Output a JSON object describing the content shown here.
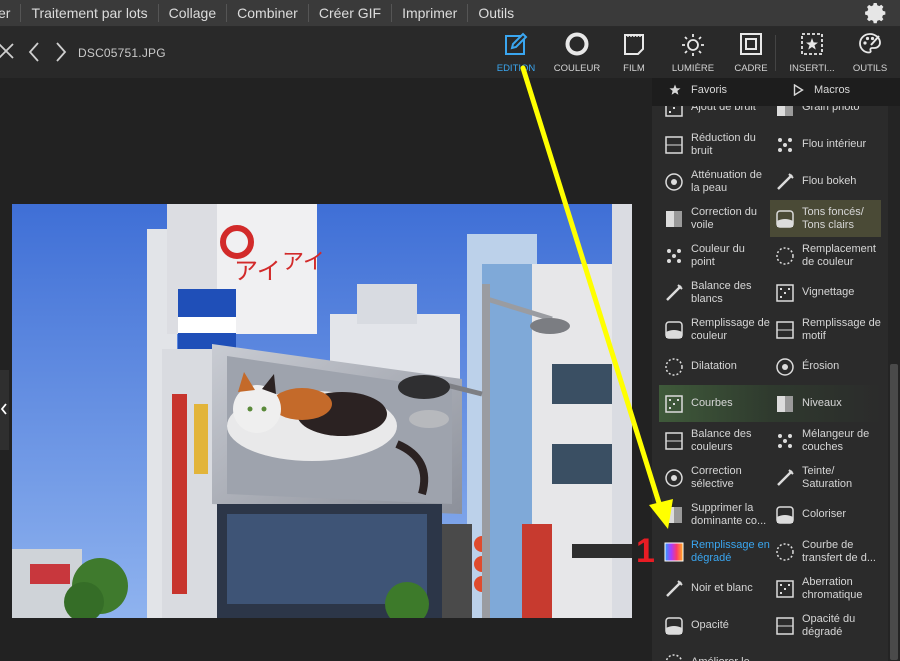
{
  "menu": {
    "items": [
      "er",
      "Traitement par lots",
      "Collage",
      "Combiner",
      "Créer GIF",
      "Imprimer",
      "Outils"
    ],
    "settings_icon": "gear-icon"
  },
  "toolbar": {
    "filename": "DSC05751.JPG",
    "tools": [
      {
        "label": "EDITION",
        "icon": "pencil-box-icon",
        "active": true
      },
      {
        "label": "COULEUR",
        "icon": "circle-icon"
      },
      {
        "label": "FILM",
        "icon": "film-frame-icon"
      },
      {
        "label": "LUMIÈRE",
        "icon": "sun-icon"
      },
      {
        "label": "CADRE",
        "icon": "frame-icon"
      },
      {
        "label": "INSERTI...",
        "icon": "insert-star-icon"
      },
      {
        "label": "OUTILS",
        "icon": "palette-icon"
      }
    ],
    "accent_color": "#3aa6f0"
  },
  "panel": {
    "tabs": [
      {
        "label": "Favoris",
        "icon": "star-icon"
      },
      {
        "label": "Macros",
        "icon": "play-icon"
      }
    ],
    "tools_left": [
      [
        "Ajout de bruit"
      ],
      [
        "Réduction du",
        "bruit"
      ],
      [
        "Atténuation de",
        "la peau"
      ],
      [
        "Correction du",
        "voile"
      ],
      [
        "Couleur du",
        "point"
      ],
      [
        "Balance des",
        "blancs"
      ],
      [
        "Remplissage de",
        "couleur"
      ],
      [
        "Dilatation"
      ],
      [
        "Courbes"
      ],
      [
        "Balance des",
        "couleurs"
      ],
      [
        "Correction",
        "sélective"
      ],
      [
        "Supprimer la",
        "dominante co..."
      ],
      [
        "Remplissage en",
        "dégradé"
      ],
      [
        "Noir et blanc"
      ],
      [
        "Opacité"
      ],
      [
        "Améliorer le"
      ]
    ],
    "tools_right": [
      [
        "Grain photo"
      ],
      [
        "Flou intérieur"
      ],
      [
        "Flou bokeh"
      ],
      [
        "Tons foncés/",
        "Tons clairs"
      ],
      [
        "Remplacement",
        "de couleur"
      ],
      [
        "Vignettage"
      ],
      [
        "Remplissage de",
        "motif"
      ],
      [
        "Érosion"
      ],
      [
        "Niveaux"
      ],
      [
        "Mélangeur de",
        "couches"
      ],
      [
        "Teinte/",
        "Saturation"
      ],
      [
        "Coloriser"
      ],
      [
        "Courbe de",
        "transfert de d..."
      ],
      [
        "Aberration",
        "chromatique"
      ],
      [
        "Opacité du",
        "dégradé"
      ]
    ]
  },
  "annotation": {
    "number": "1",
    "arrow_color": "#ffff00",
    "number_color": "#e81c24"
  }
}
